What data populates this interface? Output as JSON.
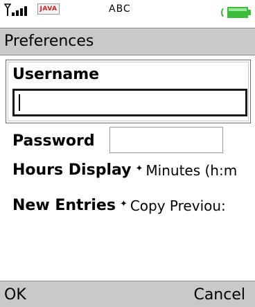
{
  "status_bar": {
    "java_badge": "JAVA",
    "mode_text": "ABC",
    "signal_icon": "signal-strength-icon",
    "battery_icon": "battery-icon"
  },
  "screen": {
    "title": "Preferences"
  },
  "form": {
    "username_label": "Username",
    "username_value": "",
    "password_label": "Password",
    "password_value": "",
    "hours_display_label": "Hours Display",
    "hours_display_value": "Minutes (h:m",
    "new_entries_label": "New Entries",
    "new_entries_value": "Copy Previou:",
    "dropdown_indicator": "✦"
  },
  "softkeys": {
    "left": "OK",
    "right": "Cancel"
  },
  "colors": {
    "bar_gray": "#c9c9c9",
    "battery_green": "#3dbb3d",
    "java_red": "#d02020"
  }
}
